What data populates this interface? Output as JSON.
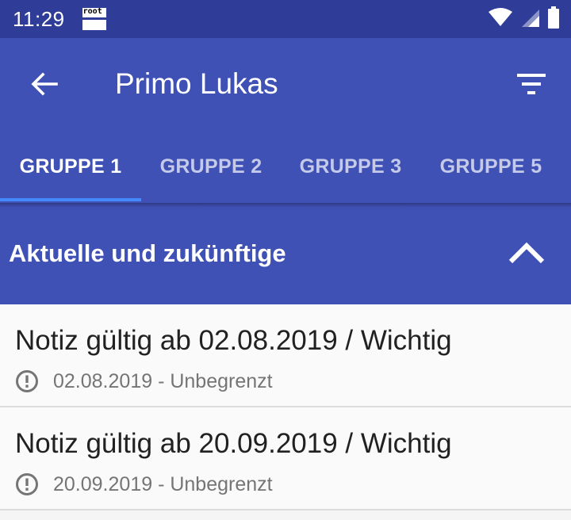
{
  "status_bar": {
    "time": "11:29",
    "root_label": "root",
    "icons": [
      "wifi-icon",
      "signal-icon",
      "battery-icon"
    ]
  },
  "toolbar": {
    "title": "Primo Lukas",
    "back_icon": "arrow-back-icon",
    "filter_icon": "filter-icon"
  },
  "tabs": [
    {
      "label": "GRUPPE 1",
      "active": true
    },
    {
      "label": "GRUPPE 2",
      "active": false
    },
    {
      "label": "GRUPPE 3",
      "active": false
    },
    {
      "label": "GRUPPE 5",
      "active": false
    }
  ],
  "section": {
    "title": "Aktuelle und zukünftige",
    "toggle_icon": "chevron-up-icon"
  },
  "notes": [
    {
      "title": "Notiz gültig ab 02.08.2019 / Wichtig",
      "subtitle": "02.08.2019 - Unbegrenzt",
      "icon": "alert-icon"
    },
    {
      "title": "Notiz gültig ab 20.09.2019 / Wichtig",
      "subtitle": "20.09.2019 - Unbegrenzt",
      "icon": "alert-icon"
    }
  ],
  "colors": {
    "status_bar": "#2f3d98",
    "primary": "#3f51b5",
    "tab_indicator": "#448aff",
    "inactive_tab": "#c5cae9"
  }
}
